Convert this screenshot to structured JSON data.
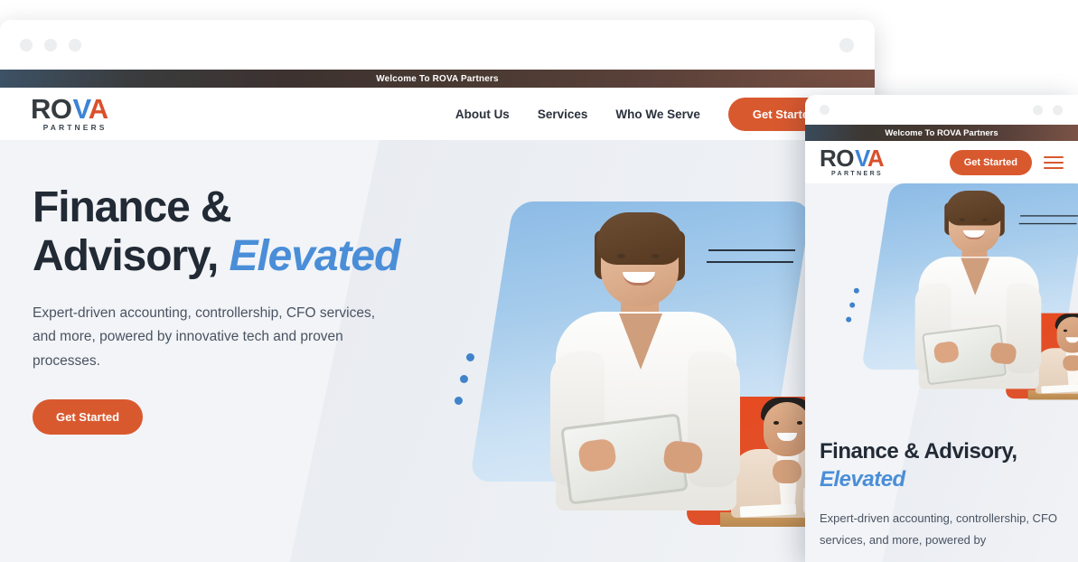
{
  "desktop_window": {
    "titlebar": {
      "left_dots": [
        "dot-1",
        "dot-2",
        "dot-3"
      ],
      "right_dot": "dot-right"
    },
    "announcement": {
      "text": "Welcome To ROVA Partners"
    },
    "nav": {
      "logo": {
        "part_ro": "RO",
        "part_v": "V",
        "part_a": "A",
        "subtitle": "PARTNERS"
      },
      "links": [
        {
          "label": "About Us"
        },
        {
          "label": "Services"
        },
        {
          "label": "Who We Serve"
        }
      ],
      "cta_label": "Get Started"
    },
    "hero": {
      "title_line1": "Finance &",
      "title_line2": "Advisory,",
      "title_emphasis": "Elevated",
      "subtitle": "Expert-driven accounting, controllership, CFO services, and more, powered by innovative tech and proven processes.",
      "cta_label": "Get Started"
    }
  },
  "mobile_window": {
    "titlebar": {
      "left_dot": "dot-1",
      "right_dots": [
        "dot-2",
        "dot-3"
      ]
    },
    "announcement": {
      "text": "Welcome To ROVA Partners"
    },
    "nav": {
      "logo": {
        "part_ro": "RO",
        "part_v": "V",
        "part_a": "A",
        "subtitle": "PARTNERS"
      },
      "cta_label": "Get Started",
      "menu_icon": "hamburger-icon"
    },
    "hero": {
      "title_line1": "Finance & Advisory,",
      "title_emphasis": "Elevated",
      "subtitle": "Expert-driven accounting, controllership, CFO services, and more, powered by"
    }
  },
  "colors": {
    "brand_orange": "#d9592f",
    "brand_blue": "#3c84d6",
    "logo_dark": "#363b3f",
    "heading_navy": "#222a35",
    "accent_blue_italic": "#4a8ed8",
    "hero_background": "#f2f4f7",
    "banner_gradient_start": "#3d5266",
    "banner_gradient_end": "#7a5144",
    "dot_blue": "#4083cb"
  }
}
